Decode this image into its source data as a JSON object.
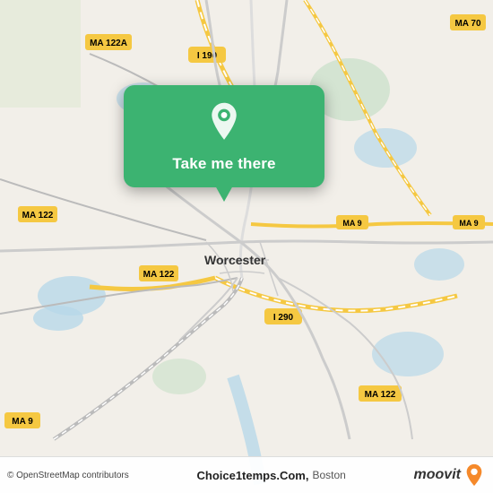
{
  "map": {
    "city": "Worcester",
    "bg_color": "#f2efe9"
  },
  "popup": {
    "button_label": "Take me there"
  },
  "footer": {
    "osm_text": "© OpenStreetMap contributors",
    "brand_name": "Choice1temps.Com,",
    "brand_city": "Boston"
  },
  "moovit": {
    "label": "moovit"
  },
  "icons": {
    "pin": "location-pin-icon",
    "moovit_pin": "moovit-pin-icon"
  }
}
